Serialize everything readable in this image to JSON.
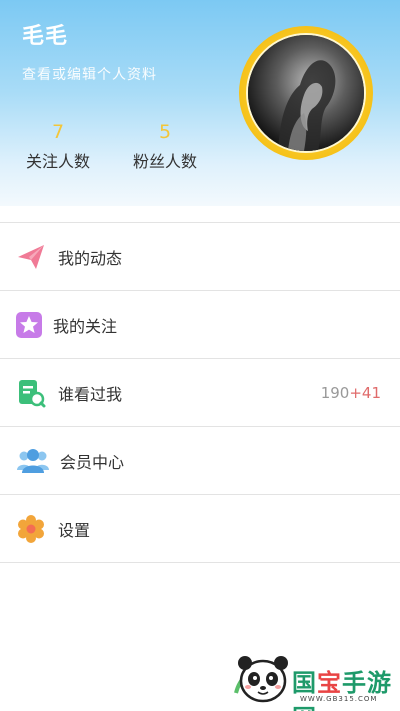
{
  "profile": {
    "name": "毛毛",
    "edit_link": "查看或编辑个人资料",
    "stats": [
      {
        "value": "7",
        "label": "关注人数"
      },
      {
        "value": "5",
        "label": "粉丝人数"
      }
    ],
    "avatar_icon": "profile-photo"
  },
  "menu": [
    {
      "label": "我的动态",
      "icon": "paper-plane-icon",
      "color": "#f07a96"
    },
    {
      "label": "我的关注",
      "icon": "star-icon",
      "color": "#c77be8"
    },
    {
      "label": "谁看过我",
      "icon": "visitor-icon",
      "color": "#3cbf7a",
      "count": "190",
      "count_new": "+41"
    },
    {
      "label": "会员中心",
      "icon": "members-icon",
      "color": "#5aa7e3"
    },
    {
      "label": "设置",
      "icon": "gear-icon",
      "color": "#f2a53a"
    }
  ],
  "watermark": {
    "text_a": "国",
    "text_b": "宝",
    "text_c": "手游网",
    "url": "WWW.GB315.COM"
  }
}
